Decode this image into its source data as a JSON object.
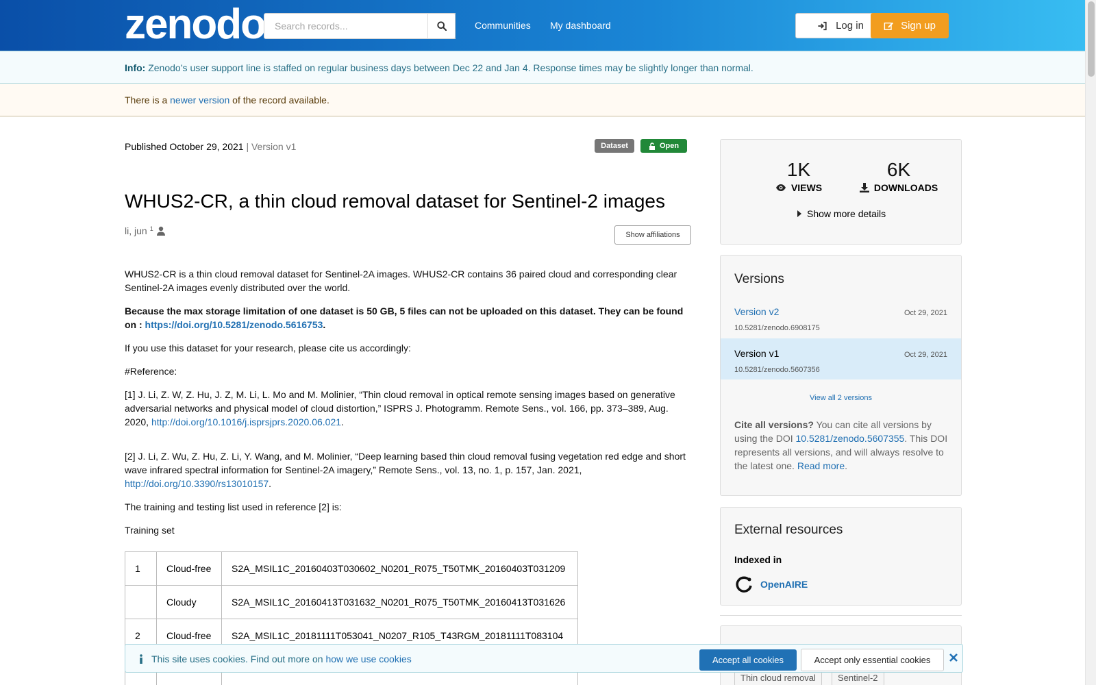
{
  "header": {
    "logo": "zenodo",
    "search_placeholder": "Search records...",
    "nav": [
      "Communities",
      "My dashboard"
    ],
    "login": "Log in",
    "signup": "Sign up",
    "colors": {
      "header_start": "#0a4fa8",
      "header_end": "#38bdf2",
      "signup": "#f29d1f"
    }
  },
  "info_banner": {
    "label": "Info:",
    "text": " Zenodo’s user support line is staffed on regular business days between Dec 22 and Jan 4. Response times may be slightly longer than normal."
  },
  "version_banner": {
    "pre": "There is a ",
    "link": "newer version",
    "post": " of the record available."
  },
  "record": {
    "published": "Published October 29, 2021",
    "version": " | Version v1",
    "badge_type": "Dataset",
    "badge_access": "Open",
    "title": "WHUS2-CR, a thin cloud removal dataset for Sentinel-2 images",
    "author": "li, jun",
    "author_sup": "1",
    "show_affiliations": "Show affiliations"
  },
  "description": {
    "p1": "WHUS2-CR is a thin cloud removal dataset for Sentinel-2A images. WHUS2-CR contains 36 paired cloud and corresponding clear Sentinel-2A images evenly distributed over the world.",
    "p2_text": "Because the max storage limitation of one dataset is 50 GB, 5 files can not be uploaded on this dataset. They can be found on : ",
    "p2_link": "https://doi.org/10.5281/zenodo.5616753",
    "p2_end": ".",
    "p3": "If you use this dataset for your research, please cite us accordingly:",
    "p4": "#Reference:",
    "ref1_text": "[1] J. Li, Z. W, Z. Hu, J. Z, M. Li, L. Mo and M. Molinier, “Thin cloud removal in optical remote sensing images based on generative adversarial networks and physical model of cloud distortion,” ISPRS J. Photogramm. Remote Sens., vol. 166, pp. 373–389, Aug. 2020, ",
    "ref1_link": "http://doi.org/10.1016/j.isprsjprs.2020.06.021",
    "ref1_end": ".",
    "ref2_text": "[2] J. Li, Z. Wu, Z. Hu, Z. Li, Y. Wang, and M. Molinier, “Deep learning based thin cloud removal fusing vegetation red edge and short wave infrared spectral information for Sentinel-2A imagery,” Remote Sens., vol. 13, no. 1, p. 157, Jan. 2021, ",
    "ref2_link": "http://doi.org/10.3390/rs13010157",
    "ref2_end": ".",
    "p5": "The training and testing list used in reference [2] is:",
    "p6": "Training set"
  },
  "training_table": [
    {
      "n": "1",
      "state": "Cloud-free",
      "file": "S2A_MSIL1C_20160403T030602_N0201_R075_T50TMK_20160403T031209"
    },
    {
      "n": "",
      "state": "Cloudy",
      "file": "S2A_MSIL1C_20160413T031632_N0201_R075_T50TMK_20160413T031626"
    },
    {
      "n": "2",
      "state": "Cloud-free",
      "file": "S2A_MSIL1C_20181111T053041_N0207_R105_T43RGM_20181111T083104"
    },
    {
      "n": "",
      "state": "",
      "file": ""
    }
  ],
  "stats": {
    "views_num": "1K",
    "views_label": "VIEWS",
    "downloads_num": "6K",
    "downloads_label": "DOWNLOADS",
    "more": "Show more details"
  },
  "versions": {
    "heading": "Versions",
    "items": [
      {
        "name": "Version v2",
        "date": "Oct 29, 2021",
        "doi": "10.5281/zenodo.6908175"
      },
      {
        "name": "Version v1",
        "date": "Oct 29, 2021",
        "doi": "10.5281/zenodo.5607356"
      }
    ],
    "view_all": "View all 2 versions",
    "cite_label": "Cite all versions?",
    "cite_text1": " You can cite all versions by using the DOI ",
    "cite_doi": "10.5281/zenodo.5607355",
    "cite_text2": ". This DOI represents all versions, and will always resolve to the latest one. ",
    "read_more": "Read more",
    "cite_end": "."
  },
  "external": {
    "heading": "External resources",
    "indexed": "Indexed in",
    "openaire": "OpenAIRE"
  },
  "keywords": [
    "Thin cloud removal",
    "Sentinel-2"
  ],
  "cookie": {
    "text": "This site uses cookies. Find out more on ",
    "link": "how we use cookies",
    "accept_all": "Accept all cookies",
    "accept_essential": "Accept only essential cookies"
  }
}
